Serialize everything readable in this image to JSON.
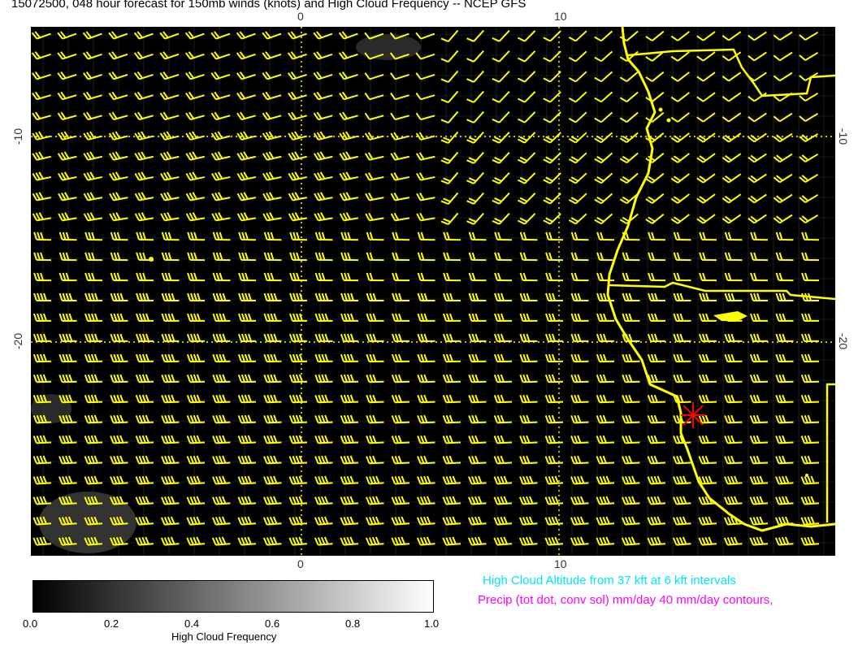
{
  "title": "15072500, 048 hour forecast for 150mb winds (knots) and High Cloud Frequency -- NCEP GFS",
  "axes": {
    "top_ticks": [
      "0",
      "10"
    ],
    "bottom_ticks": [
      "0",
      "10"
    ],
    "left_ticks": [
      "-10",
      "-20"
    ],
    "right_ticks": [
      "-10",
      "-20"
    ]
  },
  "colorbar": {
    "title": "High Cloud Frequency",
    "ticks": [
      "0.0",
      "0.2",
      "0.4",
      "0.6",
      "0.8",
      "1.0"
    ]
  },
  "legend": {
    "cloud_altitude": "High Cloud Altitude from 37 kft at 6 kft intervals",
    "precip": "Precip (tot dot, conv sol) mm/day 40 mm/day contours,"
  },
  "colors": {
    "background": "#000000",
    "barbs": "#ffff00",
    "coast": "#ffff00",
    "marker": "#ff0000",
    "legend_cloud": "#00e5ff",
    "legend_precip": "#ff00ff"
  }
}
